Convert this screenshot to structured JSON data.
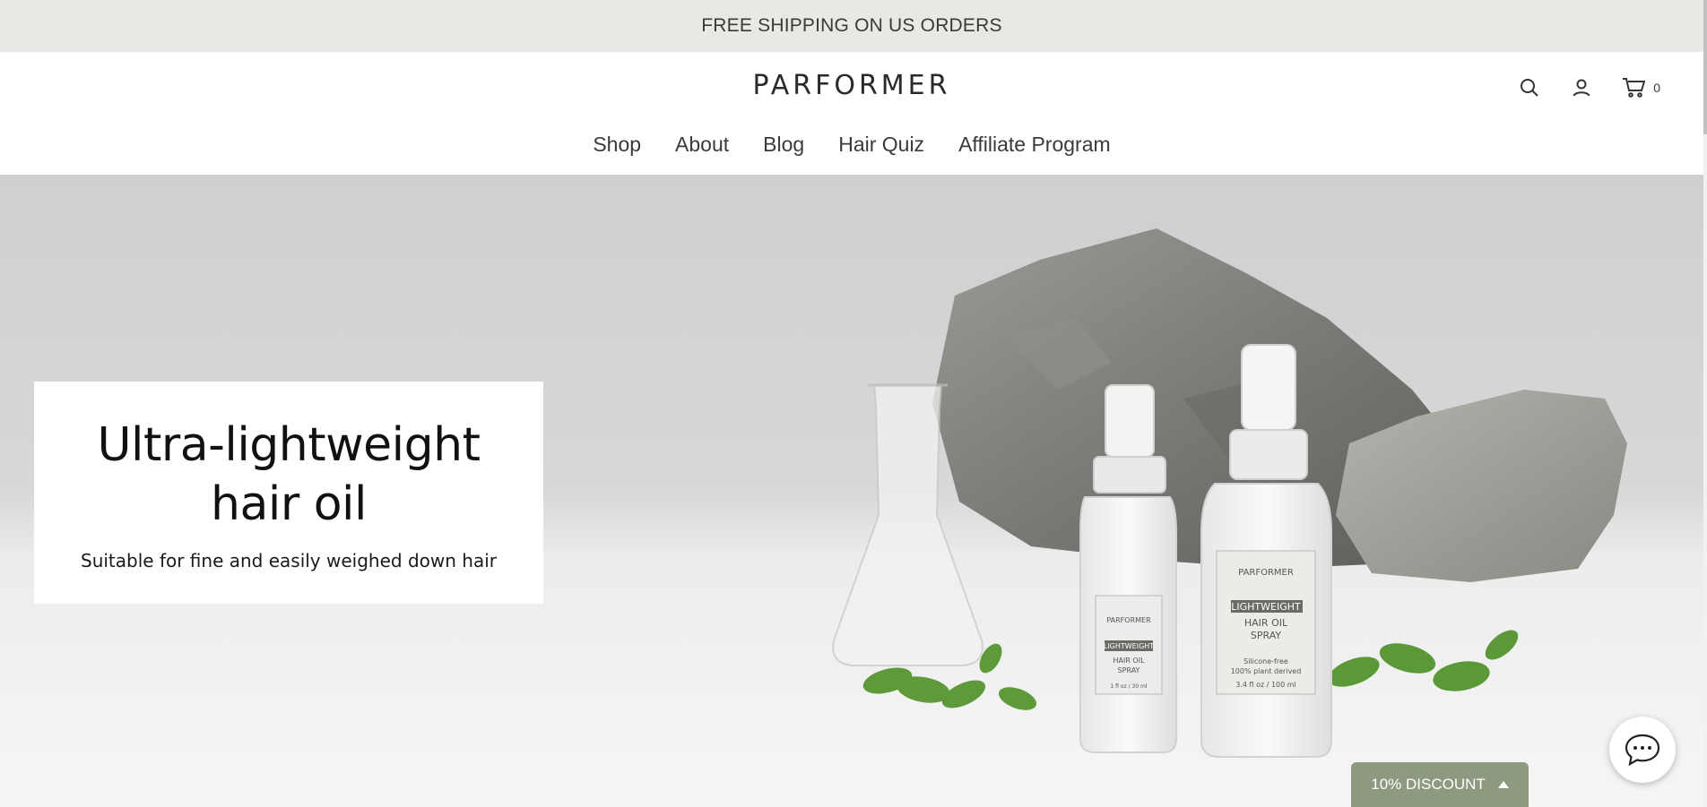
{
  "announcement": {
    "text": "FREE SHIPPING ON US ORDERS"
  },
  "header": {
    "logo": "PARFORMER",
    "cart_count": "0",
    "nav": [
      {
        "label": "Shop"
      },
      {
        "label": "About"
      },
      {
        "label": "Blog"
      },
      {
        "label": "Hair Quiz"
      },
      {
        "label": "Affiliate Program"
      }
    ]
  },
  "hero": {
    "title": "Ultra-lightweight hair oil",
    "subtitle": "Suitable for fine and easily weighed down hair",
    "product_brand": "PARFORMER",
    "product_tag": "LIGHTWEIGHT",
    "product_name_line1": "HAIR OIL",
    "product_name_line2": "SPRAY",
    "product_note1": "Silicone-free",
    "product_note2": "100% plant derived",
    "product_size_small": "1 fl oz / 30 ml",
    "product_size_large": "3.4 fl oz / 100 ml"
  },
  "discount": {
    "label": "10% DISCOUNT"
  },
  "colors": {
    "accent": "#8e9a80",
    "announcement_bg": "#e8e8e4"
  }
}
